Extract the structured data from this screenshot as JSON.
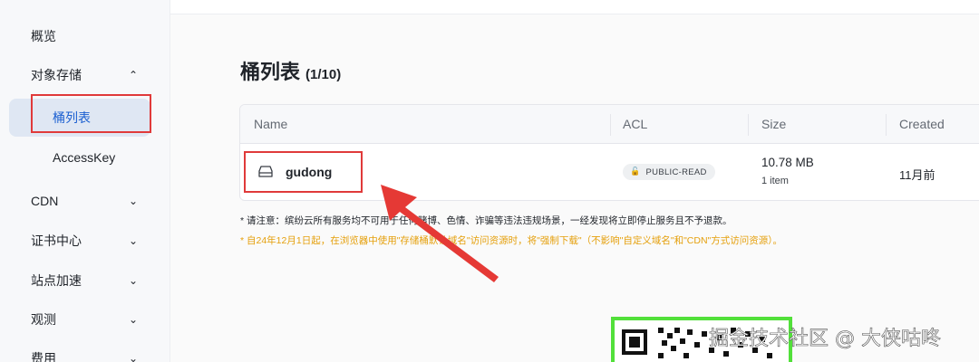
{
  "sidebar": {
    "items": [
      {
        "label": "概览"
      },
      {
        "label": "对象存储",
        "expanded": true
      },
      {
        "label": "桶列表",
        "active": true
      },
      {
        "label": "AccessKey"
      },
      {
        "label": "CDN"
      },
      {
        "label": "证书中心"
      },
      {
        "label": "站点加速"
      },
      {
        "label": "观测"
      },
      {
        "label": "费用"
      }
    ]
  },
  "page": {
    "title": "桶列表",
    "count": "(1/10)"
  },
  "table": {
    "columns": [
      "Name",
      "ACL",
      "Size",
      "Created"
    ],
    "rows": [
      {
        "name": "gudong",
        "acl": "PUBLIC-READ",
        "size": "10.78 MB",
        "items": "1 item",
        "created": "11月前"
      }
    ]
  },
  "notes": {
    "line1": "* 请注意：缤纷云所有服务均不可用于任何赌博、色情、诈骗等违法违规场景，一经发现将立即停止服务且不予退款。",
    "line2": "* 自24年12月1日起，在浏览器中使用\"存储桶默认域名\"访问资源时，将\"强制下载\"（不影响\"自定义域名\"和\"CDN\"方式访问资源）。"
  },
  "watermark": "掘金技术社区 @ 大侠咕咚",
  "colors": {
    "accent": "#1a5fd1",
    "annotation": "#e03a3a",
    "warning": "#e5a00d",
    "public": "#23b26d"
  },
  "icons": {
    "expand": "chevron-up-icon",
    "collapse": "chevron-down-icon",
    "bucket": "disk-icon",
    "acl": "lock-open-icon"
  }
}
